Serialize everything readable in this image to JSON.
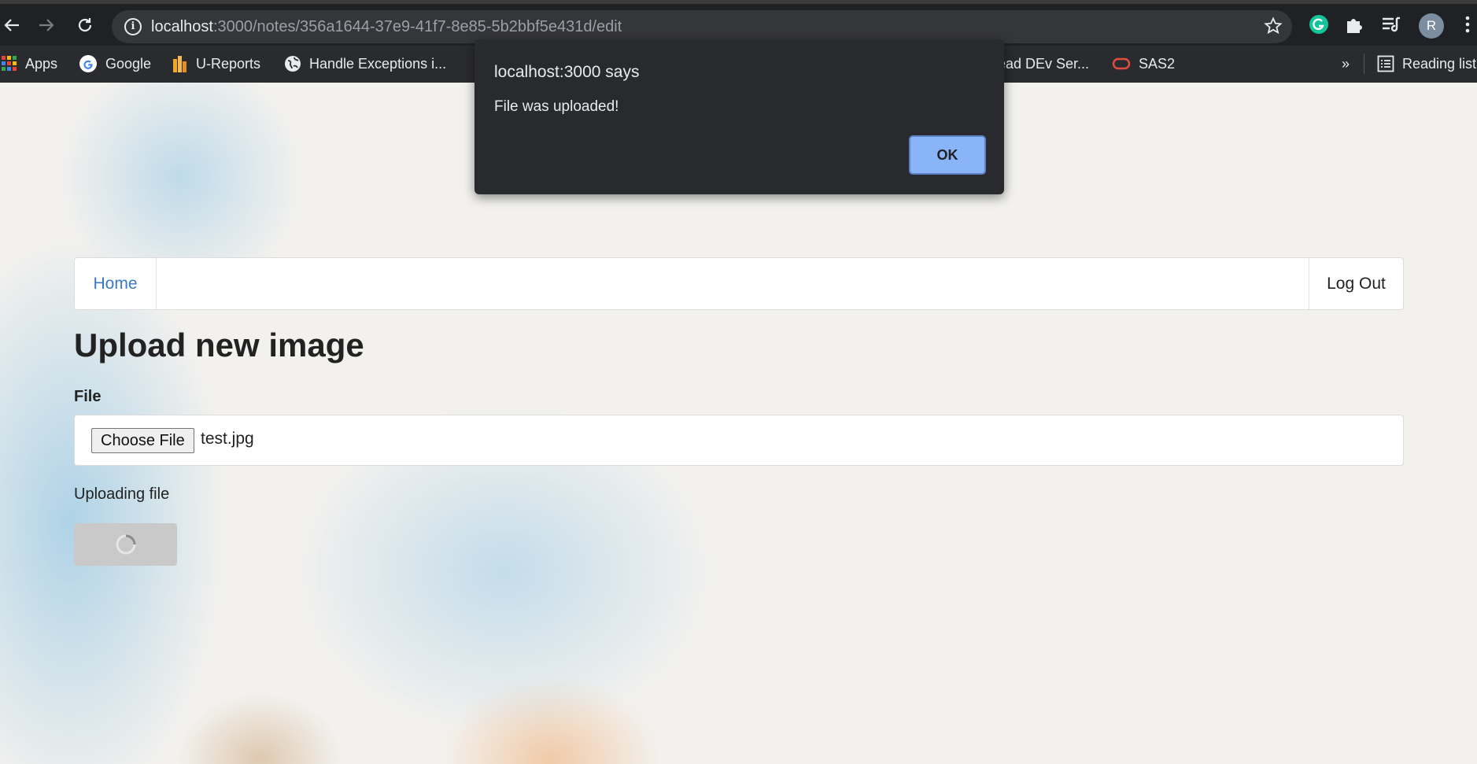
{
  "browser": {
    "url_host": "localhost",
    "url_rest": ":3000/notes/356a1644-37e9-41f7-8e85-5b2bbf5e431d/edit",
    "profile_initial": "R"
  },
  "bookmarks": {
    "items": [
      {
        "label": "Apps",
        "icon": "apps-grid-icon"
      },
      {
        "label": "Google",
        "icon": "google-icon"
      },
      {
        "label": "U-Reports",
        "icon": "ureports-icon"
      },
      {
        "label": "Handle Exceptions i...",
        "icon": "globe-icon"
      },
      {
        "label": "ead DEv Ser...",
        "icon": "bookmark-icon"
      },
      {
        "label": "SAS2",
        "icon": "oracle-icon"
      }
    ],
    "overflow": "»",
    "reading_list": "Reading list"
  },
  "nav": {
    "home": "Home",
    "logout": "Log Out"
  },
  "page": {
    "title": "Upload new image",
    "file_label": "File",
    "choose_button": "Choose File",
    "file_name": "test.jpg",
    "status": "Uploading file"
  },
  "dialog": {
    "title": "localhost:3000 says",
    "message": "File was uploaded!",
    "ok": "OK"
  },
  "colors": {
    "link": "#3a7ac0",
    "dialog_bg": "#292a2d",
    "ok_button": "#8ab4f8"
  }
}
